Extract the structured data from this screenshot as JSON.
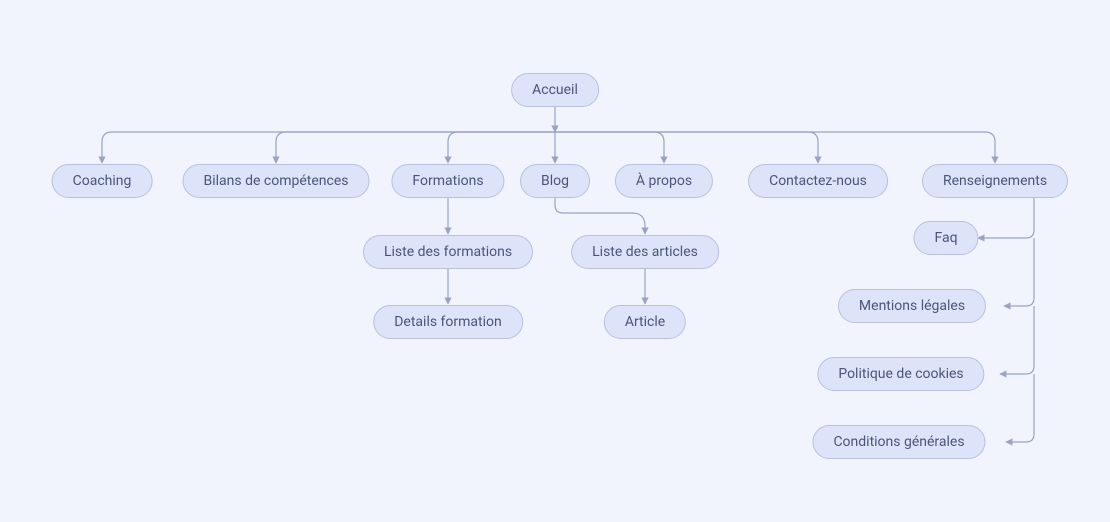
{
  "diagram": {
    "root": "Accueil",
    "level1": {
      "coaching": "Coaching",
      "bilans": "Bilans de compétences",
      "formations": "Formations",
      "blog": "Blog",
      "apropos": "À propos",
      "contact": "Contactez-nous",
      "renseignements": "Renseignements"
    },
    "formations_children": {
      "liste": "Liste des formations",
      "detail": "Details formation"
    },
    "blog_children": {
      "liste": "Liste des articles",
      "article": "Article"
    },
    "renseignements_children": {
      "faq": "Faq",
      "mentions": "Mentions légales",
      "cookies": "Politique de cookies",
      "conditions": "Conditions générales"
    }
  }
}
